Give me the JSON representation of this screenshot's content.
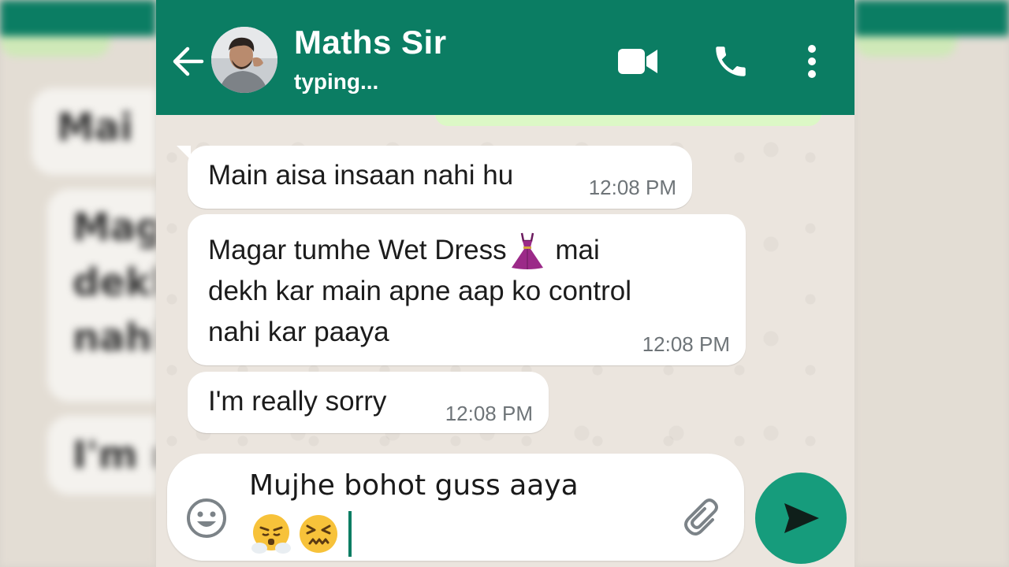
{
  "header": {
    "contact_name": "Maths Sir",
    "status": "typing..."
  },
  "icons": {
    "back": "arrow-left-icon",
    "video": "video-camera-icon",
    "call": "phone-icon",
    "menu": "more-vertical-icon",
    "emoji": "smiley-icon",
    "attach": "paperclip-icon",
    "send": "send-icon",
    "dress_emoji": "dress-icon",
    "face_steam": "face-with-steam-icon",
    "face_confounded": "confounded-face-icon"
  },
  "messages": [
    {
      "lines": [
        "Main aisa insaan nahi hu"
      ],
      "time": "12:08 PM",
      "direction": "incoming"
    },
    {
      "lines": [
        "Magar tumhe Wet  Dress",
        "mai",
        "dekh kar main apne aap ko control",
        "nahi kar paaya"
      ],
      "time": "12:08 PM",
      "direction": "incoming"
    },
    {
      "lines": [
        "I'm really sorry"
      ],
      "time": "12:08 PM",
      "direction": "incoming"
    }
  ],
  "composer": {
    "value": "Mujhe bohot guss aaya"
  },
  "background_blur": {
    "left_texts": [
      "Mai",
      "Mag",
      "dekh",
      "nahi",
      "I'm r"
    ]
  },
  "colors": {
    "header": "#0b7d63",
    "send_button": "#169c7c",
    "bubble": "#ffffff",
    "outgoing_bubble": "#dcf8c6",
    "chat_bg": "#ebe5de"
  }
}
